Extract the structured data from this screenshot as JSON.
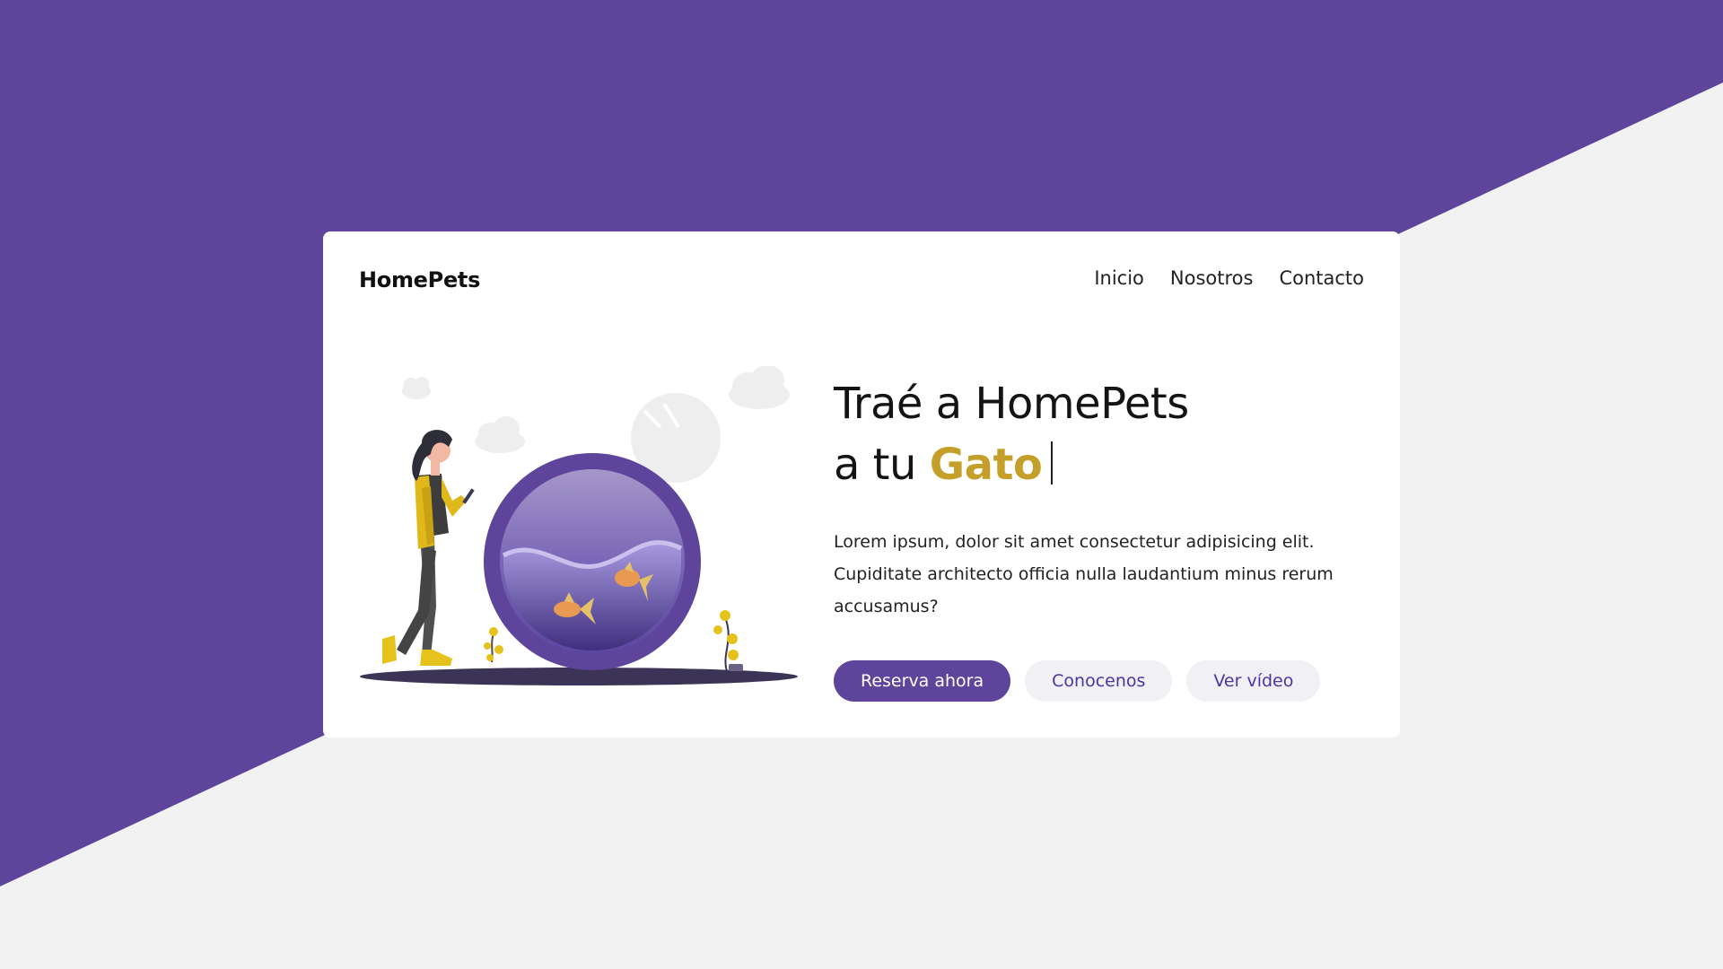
{
  "brand": "HomePets",
  "nav": {
    "items": [
      "Inicio",
      "Nosotros",
      "Contacto"
    ]
  },
  "hero": {
    "line1": "Traé a HomePets",
    "line2_prefix": "a tu",
    "highlight": "Gato",
    "description": "Lorem ipsum, dolor sit amet consectetur adipisicing elit. Cupiditate architecto officia nulla laudantium minus rerum accusamus?",
    "buttons": {
      "primary": "Reserva ahora",
      "secondary": "Conocenos",
      "video": "Ver vídeo"
    }
  },
  "colors": {
    "brand_purple": "#5e449b",
    "accent_gold": "#c4a02a",
    "background_light": "#f2f2f2",
    "card_white": "#ffffff"
  },
  "illustration": {
    "subject": "woman-with-phone-next-to-fishbowl",
    "icons": [
      "cloud-icon",
      "moon-icon",
      "fishbowl-icon",
      "goldfish-icon",
      "plant-icon"
    ]
  }
}
